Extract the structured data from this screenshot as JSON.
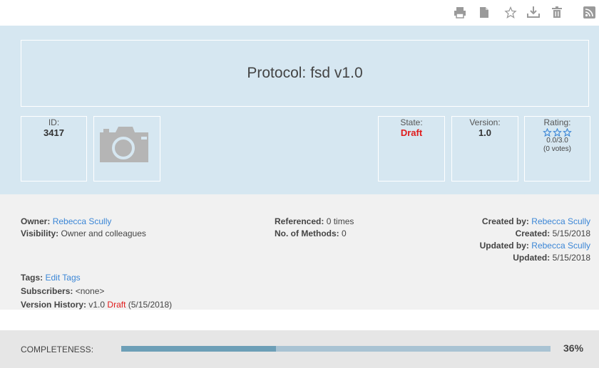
{
  "toolbar": {
    "icons": [
      "print-icon",
      "document-icon",
      "star-icon",
      "download-icon",
      "trash-icon",
      "rss-icon"
    ]
  },
  "protocol": {
    "title": "Protocol: fsd v1.0",
    "id_label": "ID:",
    "id_value": "3417",
    "state_label": "State:",
    "state_value": "Draft",
    "version_label": "Version:",
    "version_value": "1.0",
    "rating_label": "Rating:",
    "rating_score": "0.0/3.0",
    "rating_votes": "(0 votes)",
    "rating_stars_filled": 0,
    "rating_stars_total": 3
  },
  "info": {
    "owner_label": "Owner:",
    "owner_value": "Rebecca Scully",
    "visibility_label": "Visibility:",
    "visibility_value": "Owner and colleagues",
    "referenced_label": "Referenced:",
    "referenced_value": "0 times",
    "methods_label": "No. of Methods:",
    "methods_value": "0",
    "created_by_label": "Created by:",
    "created_by_value": "Rebecca Scully",
    "created_label": "Created:",
    "created_value": "5/15/2018",
    "updated_by_label": "Updated by:",
    "updated_by_value": "Rebecca Scully",
    "updated_label": "Updated:",
    "updated_value": "5/15/2018",
    "tags_label": "Tags:",
    "tags_link": "Edit Tags",
    "subscribers_label": "Subscribers:",
    "subscribers_value": "<none>",
    "version_history_label": "Version History:",
    "version_history_version": "v1.0",
    "version_history_state": "Draft",
    "version_history_date": "(5/15/2018)"
  },
  "completeness": {
    "label": "COMPLETENESS:",
    "percent_text": "36%",
    "fraction": 0.36
  },
  "colors": {
    "link": "#3b86d6",
    "draft_red": "#e01b1b",
    "header_bg": "#d6e7f1",
    "bar_fill": "#6d9fb7",
    "bar_track": "#a9c3d3"
  }
}
